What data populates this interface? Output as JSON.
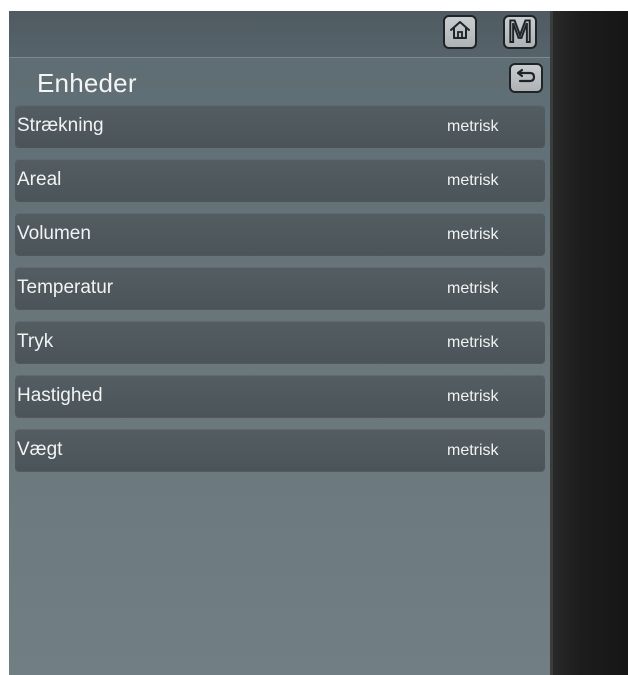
{
  "topbar": {
    "home_icon": "home-icon",
    "mode_label": "M"
  },
  "header": {
    "title": "Enheder",
    "back_icon": "back-arrow-icon"
  },
  "units": [
    {
      "label": "Strækning",
      "value": "metrisk"
    },
    {
      "label": "Areal",
      "value": "metrisk"
    },
    {
      "label": "Volumen",
      "value": "metrisk"
    },
    {
      "label": "Temperatur",
      "value": "metrisk"
    },
    {
      "label": "Tryk",
      "value": "metrisk"
    },
    {
      "label": "Hastighed",
      "value": "metrisk"
    },
    {
      "label": "Vægt",
      "value": "metrisk"
    }
  ],
  "colors": {
    "panel_background": "#68767c",
    "row_background": "#4f5a5f",
    "text": "#f2f3f3",
    "button_face": "#bfc3c5"
  }
}
